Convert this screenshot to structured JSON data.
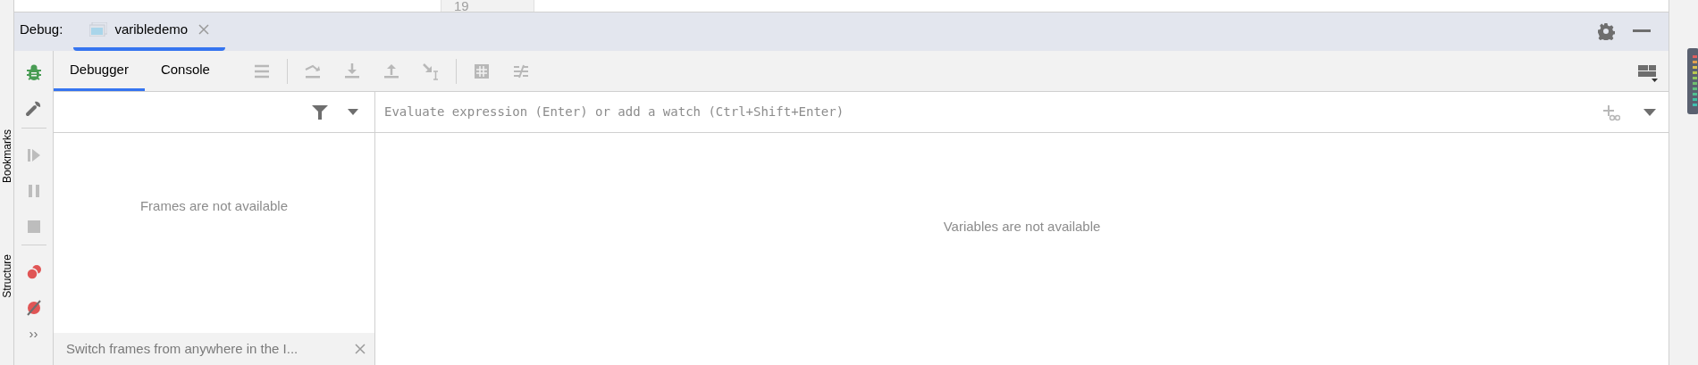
{
  "editor": {
    "line_number": "19"
  },
  "side_labels": [
    "Bookmarks",
    "Structure"
  ],
  "debug_header": {
    "label": "Debug:",
    "sessions": [
      {
        "label": "varibledemo",
        "selected": true
      }
    ]
  },
  "tabs": [
    {
      "label": "Debugger",
      "selected": true
    },
    {
      "label": "Console",
      "selected": false
    }
  ],
  "toolbar": [
    {
      "kind": "menu",
      "disabled": true
    },
    {
      "kind": "step-over",
      "disabled": true
    },
    {
      "kind": "step-into",
      "disabled": true
    },
    {
      "kind": "step-out",
      "disabled": true
    },
    {
      "kind": "run-to-cursor",
      "disabled": true
    },
    {
      "kind": "evaluate",
      "disabled": true
    },
    {
      "kind": "trace",
      "disabled": true
    }
  ],
  "side_actions": [
    {
      "kind": "resume",
      "disabled": true
    },
    {
      "kind": "pause",
      "disabled": true
    },
    {
      "kind": "stop",
      "disabled": true
    },
    {
      "kind": "breakpoints",
      "disabled": false
    },
    {
      "kind": "mute",
      "disabled": false
    }
  ],
  "more_label": "››",
  "frames": {
    "message": "Frames are not available",
    "hint": "Switch frames from anywhere in the I..."
  },
  "variables": {
    "placeholder": "Evaluate expression (Enter) or add a watch (Ctrl+Shift+Enter)",
    "message": "Variables are not available"
  }
}
